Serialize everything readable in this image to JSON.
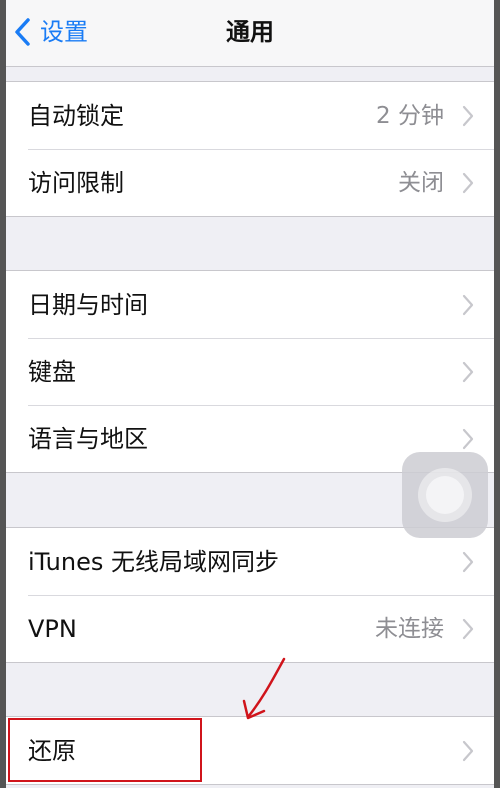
{
  "navbar": {
    "back_label": "设置",
    "title": "通用"
  },
  "groups": [
    {
      "rows": [
        {
          "label": "自动锁定",
          "value": "2 分钟"
        },
        {
          "label": "访问限制",
          "value": "关闭"
        }
      ]
    },
    {
      "rows": [
        {
          "label": "日期与时间",
          "value": ""
        },
        {
          "label": "键盘",
          "value": ""
        },
        {
          "label": "语言与地区",
          "value": ""
        }
      ]
    },
    {
      "rows": [
        {
          "label": "iTunes 无线局域网同步",
          "value": ""
        },
        {
          "label": "VPN",
          "value": "未连接"
        }
      ]
    },
    {
      "rows": [
        {
          "label": "还原",
          "value": ""
        }
      ]
    }
  ],
  "icons": {
    "back": "chevron-left-icon",
    "disclosure": "chevron-right-icon",
    "assistive_touch": "assistive-touch-icon",
    "annotation_arrow": "arrow-icon"
  },
  "colors": {
    "accent": "#1a7cf5",
    "annotation": "#d0141b",
    "background": "#efeff4",
    "secondary_text": "#8e8e93"
  }
}
